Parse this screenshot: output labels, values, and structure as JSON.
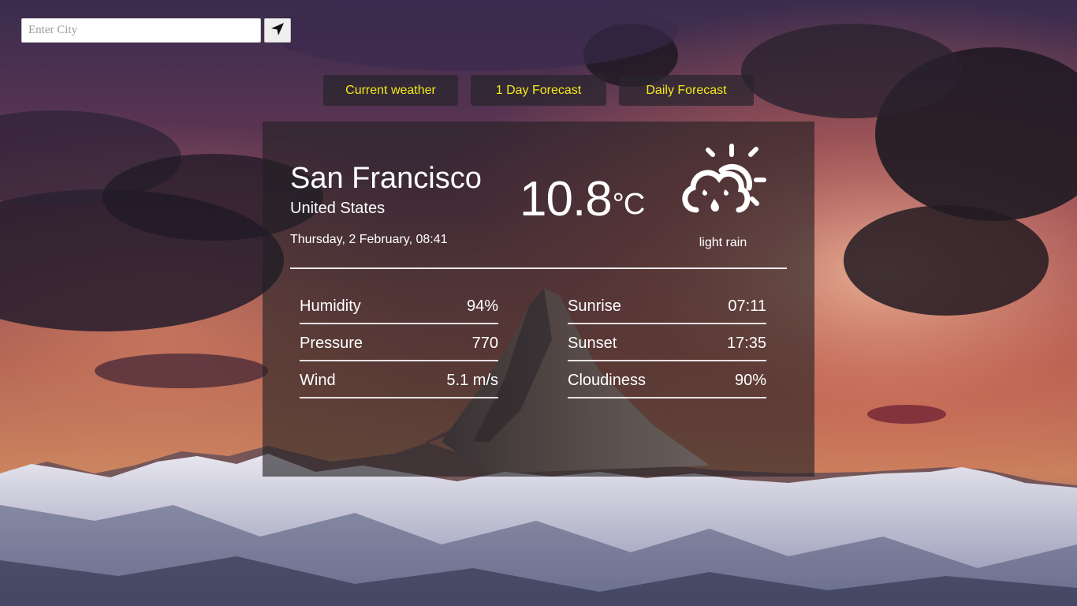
{
  "search": {
    "placeholder": "Enter City",
    "value": ""
  },
  "tabs": [
    {
      "label": "Current weather"
    },
    {
      "label": "1 Day Forecast"
    },
    {
      "label": "Daily Forecast"
    }
  ],
  "weather": {
    "city": "San Francisco",
    "country": "United States",
    "datetime": "Thursday, 2 February, 08:41",
    "temperature": "10.8",
    "unit": "°C",
    "description": "light rain",
    "icon": "partly-cloudy-rain-icon"
  },
  "stats_left": [
    {
      "label": "Humidity",
      "value": "94%"
    },
    {
      "label": "Pressure",
      "value": "770"
    },
    {
      "label": "Wind",
      "value": "5.1 m/s"
    }
  ],
  "stats_right": [
    {
      "label": "Sunrise",
      "value": "07:11"
    },
    {
      "label": "Sunset",
      "value": "17:35"
    },
    {
      "label": "Cloudiness",
      "value": "90%"
    }
  ],
  "colors": {
    "tab_text": "#f2ea18",
    "text": "#ffffff"
  }
}
